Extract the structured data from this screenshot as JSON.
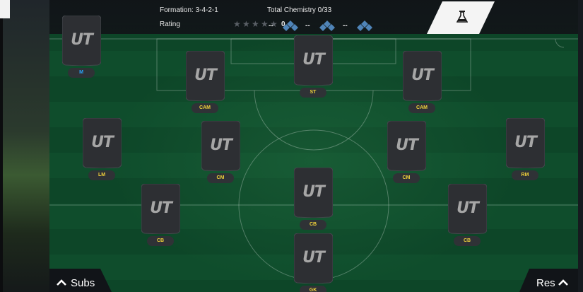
{
  "header": {
    "formation": "Formation: 3-4-2-1",
    "rating_label": "Rating",
    "rating_stars_filled": 0,
    "rating_stars_total": 5,
    "rating_value": "0",
    "chemistry_label": "Total Chemistry 0/33",
    "chem_slots": [
      "--",
      "--",
      "--"
    ],
    "lab_icon": "flask-icon"
  },
  "card_logo": "UT",
  "players": [
    {
      "pos": "M",
      "color": "#2aa7ff"
    },
    {
      "pos": "CAM",
      "color": "#f1d23b"
    },
    {
      "pos": "ST",
      "color": "#f1d23b"
    },
    {
      "pos": "CAM",
      "color": "#f1d23b"
    },
    {
      "pos": "LM",
      "color": "#f1d23b"
    },
    {
      "pos": "CM",
      "color": "#f1d23b"
    },
    {
      "pos": "CM",
      "color": "#f1d23b"
    },
    {
      "pos": "RM",
      "color": "#f1d23b"
    },
    {
      "pos": "CB",
      "color": "#f1d23b"
    },
    {
      "pos": "CB",
      "color": "#f1d23b"
    },
    {
      "pos": "CB",
      "color": "#f1d23b"
    },
    {
      "pos": "GK",
      "color": "#f1d23b"
    }
  ],
  "controls": {
    "subs_label": "Subs",
    "res_label": "Res"
  },
  "colors": {
    "pitch": "#0f4d2c",
    "position_text": "#f1d23b",
    "manager_text": "#2aa7ff",
    "card": "#2d2f33"
  }
}
